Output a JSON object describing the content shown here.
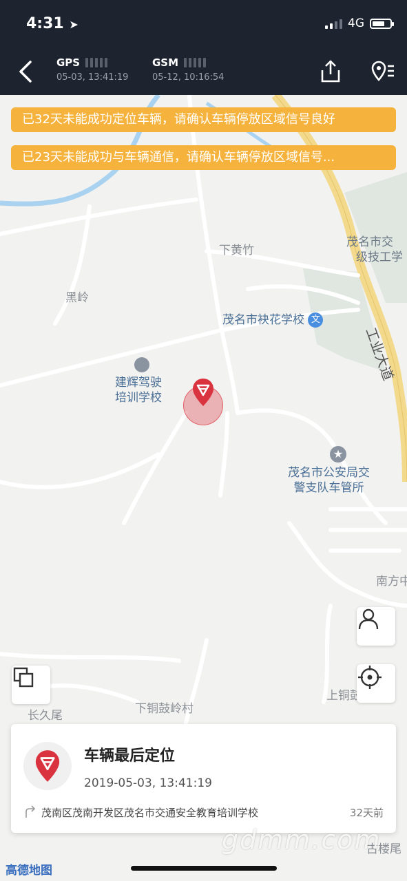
{
  "status_bar": {
    "time": "4:31",
    "network": "4G"
  },
  "nav": {
    "gps_label": "GPS",
    "gps_time": "05-03, 13:41:19",
    "gsm_label": "GSM",
    "gsm_time": "05-12, 10:16:54"
  },
  "alerts": [
    "已32天未能成功定位车辆，请确认车辆停放区域信号良好",
    "已23天未能成功与车辆通信，请确认车辆停放区域信号..."
  ],
  "map_labels": {
    "xia_huang_zhu": "下黄竹",
    "hei_ling": "黑岭",
    "qi_hua_school": "茂名市袂花学校",
    "driving_school_1": "建辉驾驶",
    "driving_school_2": "培训学校",
    "police_1": "茂名市公安局交",
    "police_2": "警支队车管所",
    "tech_school_1": "茂名市交",
    "tech_school_2": "级技工学",
    "industry_road": "工业大道",
    "nan_fang": "南方中",
    "shang_tong": "上铜鼓",
    "xia_tong_village": "下铜鼓岭村",
    "chang_jiu_wei": "长久尾",
    "gu_lou_wei": "古楼尾"
  },
  "card": {
    "title": "车辆最后定位",
    "time": "2019-05-03, 13:41:19",
    "address": "茂南区茂南开发区茂名市交通安全教育培训学校",
    "ago": "32天前"
  },
  "map_provider": "高德地图",
  "watermark": "gdmm.com",
  "colors": {
    "alert": "#f5b33e",
    "header": "#1d2430",
    "pin": "#d9333f",
    "road": "#f3d98c"
  },
  "icons": [
    "back-icon",
    "upload-icon",
    "location-list-icon",
    "layers-icon",
    "person-icon",
    "locate-icon",
    "school-icon",
    "police-star-icon"
  ]
}
